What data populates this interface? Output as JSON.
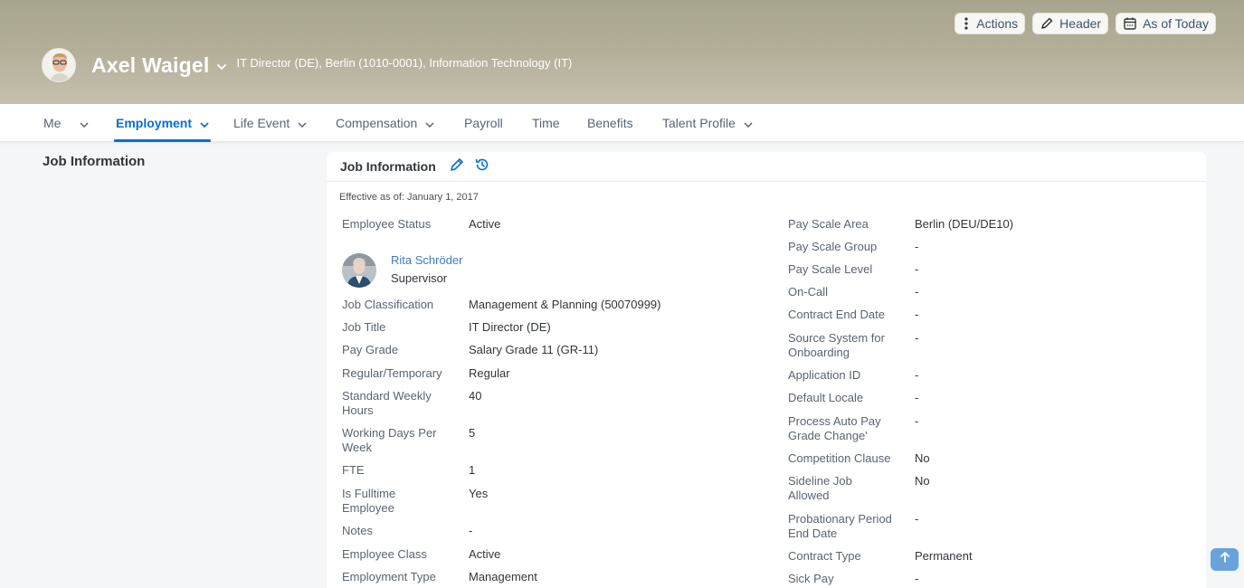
{
  "header": {
    "employee_name": "Axel Waigel",
    "employee_subtitle": "IT Director (DE), Berlin (1010-0001), Information Technology (IT)",
    "actions": [
      {
        "label": "Actions",
        "icon": "more-vertical-icon"
      },
      {
        "label": "Header",
        "icon": "pencil-icon"
      },
      {
        "label": "As of Today",
        "icon": "calendar-icon"
      }
    ]
  },
  "tabs": [
    {
      "label": "Me",
      "has_dropdown": true,
      "active": false
    },
    {
      "label": "Employment",
      "has_dropdown": true,
      "active": true
    },
    {
      "label": "Life Event",
      "has_dropdown": true,
      "active": false
    },
    {
      "label": "Compensation",
      "has_dropdown": true,
      "active": false
    },
    {
      "label": "Payroll",
      "has_dropdown": false,
      "active": false
    },
    {
      "label": "Time",
      "has_dropdown": false,
      "active": false
    },
    {
      "label": "Benefits",
      "has_dropdown": false,
      "active": false
    },
    {
      "label": "Talent Profile",
      "has_dropdown": true,
      "active": false
    }
  ],
  "side_section": {
    "title": "Job Information"
  },
  "card": {
    "title": "Job Information",
    "effective": "Effective as of: January 1, 2017",
    "supervisor": {
      "name": "Rita Schröder",
      "role": "Supervisor"
    },
    "left_fields": [
      {
        "label": "Employee Status",
        "value": "Active"
      },
      {
        "label": "Job Classification",
        "value": "Management & Planning (50070999)"
      },
      {
        "label": "Job Title",
        "value": "IT Director (DE)"
      },
      {
        "label": "Pay Grade",
        "value": "Salary Grade 11 (GR-11)"
      },
      {
        "label": "Regular/Temporary",
        "value": "Regular"
      },
      {
        "label": "Standard Weekly Hours",
        "value": "40"
      },
      {
        "label": "Working Days Per Week",
        "value": "5"
      },
      {
        "label": "FTE",
        "value": "1"
      },
      {
        "label": "Is Fulltime Employee",
        "value": "Yes"
      },
      {
        "label": "Notes",
        "value": "-"
      },
      {
        "label": "Employee Class",
        "value": "Active"
      },
      {
        "label": "Employment Type",
        "value": "Management"
      }
    ],
    "right_fields": [
      {
        "label": "Pay Scale Area",
        "value": "Berlin (DEU/DE10)"
      },
      {
        "label": "Pay Scale Group",
        "value": "-"
      },
      {
        "label": "Pay Scale Level",
        "value": "-"
      },
      {
        "label": "On-Call",
        "value": "-"
      },
      {
        "label": "Contract End Date",
        "value": "-"
      },
      {
        "label": "Source System for Onboarding",
        "value": "-"
      },
      {
        "label": "Application ID",
        "value": "-"
      },
      {
        "label": "Default Locale",
        "value": "-"
      },
      {
        "label": "Process Auto Pay Grade Change'",
        "value": "-"
      },
      {
        "label": "Competition Clause",
        "value": "No"
      },
      {
        "label": "Sideline Job Allowed",
        "value": "No"
      },
      {
        "label": "Probationary Period End Date",
        "value": "-"
      },
      {
        "label": "Contract Type",
        "value": "Permanent"
      },
      {
        "label": "Sick Pay",
        "value": "-"
      }
    ]
  },
  "colors": {
    "accent": "#0a6ed1",
    "link": "#3f7cbf",
    "scroll_button": "#69a3dc"
  }
}
